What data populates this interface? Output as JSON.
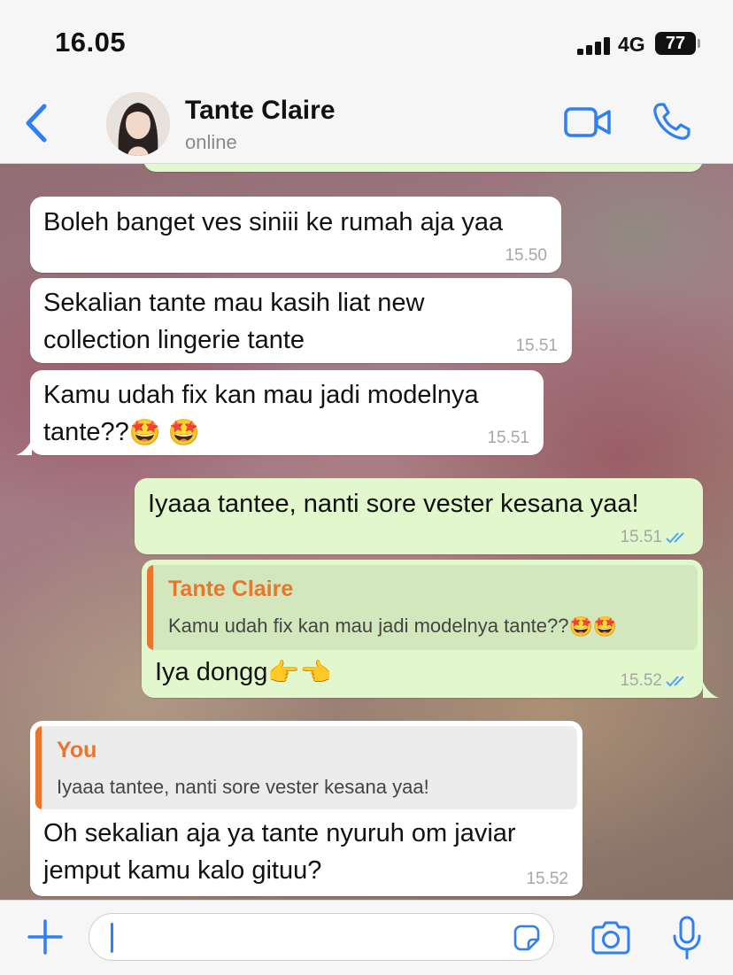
{
  "status_bar": {
    "time": "16.05",
    "network": "4G",
    "battery": "77"
  },
  "header": {
    "contact_name": "Tante Claire",
    "contact_status": "online"
  },
  "messages": [
    {
      "direction": "incoming",
      "text": "Boleh banget ves siniii ke rumah aja yaa",
      "time": "15.50"
    },
    {
      "direction": "incoming",
      "lines": [
        "Sekalian tante mau kasih liat new",
        "collection lingerie tante"
      ],
      "time": "15.51"
    },
    {
      "direction": "incoming",
      "lines": [
        "Kamu udah fix kan mau jadi modelnya",
        "tante??"
      ],
      "emoji": "🤩 🤩",
      "time": "15.51"
    },
    {
      "direction": "outgoing",
      "text": "Iyaaa tantee, nanti sore vester kesana yaa!",
      "time": "15.51",
      "read": true
    },
    {
      "direction": "outgoing",
      "quote": {
        "author": "Tante Claire",
        "text": "Kamu udah fix kan mau jadi modelnya tante??",
        "emoji": "🤩🤩"
      },
      "text": "Iya dongg",
      "emoji": "👉👈",
      "time": "15.52",
      "read": true
    },
    {
      "direction": "incoming",
      "quote": {
        "author": "You",
        "text": "Iyaaa tantee, nanti sore vester kesana yaa!"
      },
      "lines": [
        "Oh sekalian aja ya tante nyuruh om javiar",
        "jemput kamu kalo gituu?"
      ],
      "time": "15.52"
    }
  ],
  "input": {
    "placeholder": ""
  },
  "colors": {
    "accent": "#2f7ff5",
    "outgoing_bubble": "#e2f7cb",
    "incoming_bubble": "#ffffff",
    "quote_author": "#e8762f",
    "read_ticks": "#53a6f0"
  }
}
